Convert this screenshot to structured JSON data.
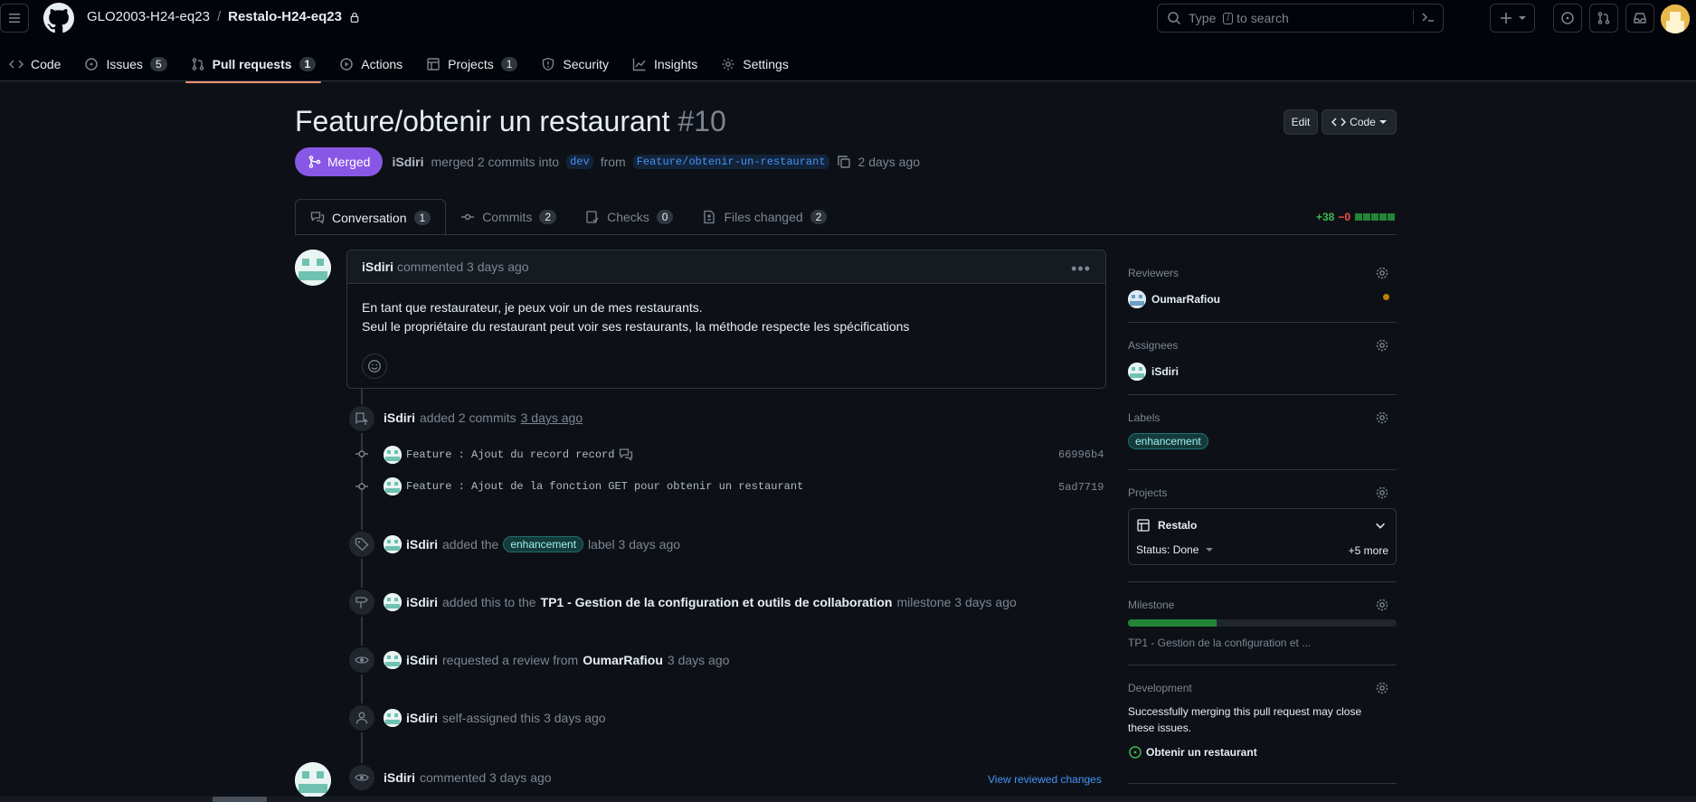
{
  "header": {
    "org": "GLO2003-H24-eq23",
    "separator": "/",
    "repo": "Restalo-H24-eq23",
    "search_placeholder_before": "Type",
    "search_key": "/",
    "search_placeholder_after": "to search"
  },
  "repo_tabs": [
    {
      "label": "Code",
      "count": null
    },
    {
      "label": "Issues",
      "count": "5"
    },
    {
      "label": "Pull requests",
      "count": "1"
    },
    {
      "label": "Actions",
      "count": null
    },
    {
      "label": "Projects",
      "count": "1"
    },
    {
      "label": "Security",
      "count": null
    },
    {
      "label": "Insights",
      "count": null
    },
    {
      "label": "Settings",
      "count": null
    }
  ],
  "pr": {
    "title": "Feature/obtenir un restaurant",
    "number": "#10",
    "edit_label": "Edit",
    "code_label": "Code",
    "state": "Merged",
    "author": "iSdiri",
    "merged_text": "merged 2 commits into",
    "base_branch": "dev",
    "from_text": "from",
    "head_branch": "Feature/obtenir-un-restaurant",
    "time": "2 days ago"
  },
  "pr_tabs": [
    {
      "label": "Conversation",
      "count": "1"
    },
    {
      "label": "Commits",
      "count": "2"
    },
    {
      "label": "Checks",
      "count": "0"
    },
    {
      "label": "Files changed",
      "count": "2"
    }
  ],
  "diffstat": {
    "additions": "+38",
    "deletions": "−0"
  },
  "comment": {
    "author": "iSdiri",
    "meta": "commented 3 days ago",
    "line1": "En tant que restaurateur, je peux voir un de mes restaurants.",
    "line2": "Seul le propriétaire du restaurant peut voir ses restaurants, la méthode respecte les spécifications"
  },
  "timeline": {
    "commits_event": {
      "author": "iSdiri",
      "text": "added 2 commits",
      "time": "3 days ago"
    },
    "commits": [
      {
        "message": "Feature : Ajout du record record",
        "sha": "66996b4"
      },
      {
        "message": "Feature : Ajout de la fonction GET pour obtenir un restaurant",
        "sha": "5ad7719"
      }
    ],
    "label_event": {
      "author": "iSdiri",
      "pre": "added the",
      "label": "enhancement",
      "post": "label 3 days ago"
    },
    "milestone_event": {
      "author": "iSdiri",
      "pre": "added this to the",
      "milestone": "TP1 - Gestion de la configuration et outils de collaboration",
      "post": "milestone 3 days ago"
    },
    "review_event": {
      "author": "iSdiri",
      "pre": "requested a review from",
      "reviewer": "OumarRafiou",
      "post": "3 days ago"
    },
    "assign_event": {
      "author": "iSdiri",
      "text": "self-assigned this 3 days ago"
    },
    "review_comment": {
      "author": "iSdiri",
      "text": "commented 3 days ago",
      "link": "View reviewed changes"
    }
  },
  "sidebar": {
    "reviewers_title": "Reviewers",
    "reviewer": "OumarRafiou",
    "assignees_title": "Assignees",
    "assignee": "iSdiri",
    "labels_title": "Labels",
    "label": "enhancement",
    "projects_title": "Projects",
    "project_name": "Restalo",
    "project_status": "Status: Done",
    "project_more": "+5 more",
    "milestone_title": "Milestone",
    "milestone_progress": 0.33,
    "milestone_name": "TP1 - Gestion de la configuration et ...",
    "development_title": "Development",
    "development_text": "Successfully merging this pull request may close these issues.",
    "linked_issue": "Obtenir un restaurant"
  },
  "colors": {
    "accent": "#8957e5",
    "tab_underline": "#fd8c73",
    "success": "#3fb950"
  }
}
